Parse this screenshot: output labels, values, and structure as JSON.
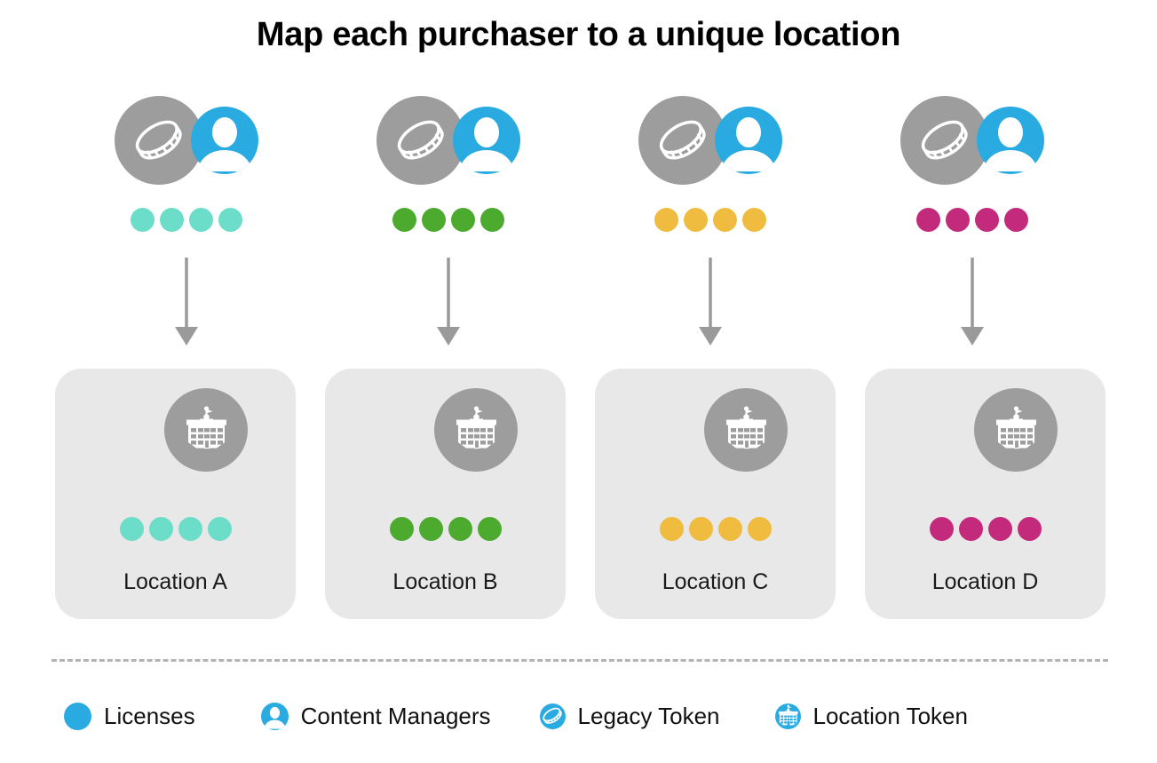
{
  "title": "Map each purchaser to a unique location",
  "colors": {
    "blue": "#29abe2",
    "gray_icon": "#9d9d9d",
    "card_bg": "#e8e8e8",
    "arrow": "#9a9a9a",
    "divider": "#b3b3b3",
    "teal": "#6bddc8",
    "green": "#4caa2e",
    "amber": "#efbc40",
    "magenta": "#c42a7c"
  },
  "purchasers": [
    {
      "token_icon": "legacy-token-icon",
      "person_icon": "content-manager-icon",
      "license_count": 4,
      "license_color": "#6bddc8"
    },
    {
      "token_icon": "legacy-token-icon",
      "person_icon": "content-manager-icon",
      "license_count": 4,
      "license_color": "#4caa2e"
    },
    {
      "token_icon": "legacy-token-icon",
      "person_icon": "content-manager-icon",
      "license_count": 4,
      "license_color": "#efbc40"
    },
    {
      "token_icon": "legacy-token-icon",
      "person_icon": "content-manager-icon",
      "license_count": 4,
      "license_color": "#c42a7c"
    }
  ],
  "arrows": [
    {
      "name": "arrow-down-a"
    },
    {
      "name": "arrow-down-b"
    },
    {
      "name": "arrow-down-c"
    },
    {
      "name": "arrow-down-d"
    }
  ],
  "locations": [
    {
      "label": "Location A",
      "token_icon": "location-token-icon",
      "license_count": 4,
      "license_color": "#6bddc8"
    },
    {
      "label": "Location B",
      "token_icon": "location-token-icon",
      "license_count": 4,
      "license_color": "#4caa2e"
    },
    {
      "label": "Location C",
      "token_icon": "location-token-icon",
      "license_count": 4,
      "license_color": "#efbc40"
    },
    {
      "label": "Location D",
      "token_icon": "location-token-icon",
      "license_count": 4,
      "license_color": "#c42a7c"
    }
  ],
  "legend": [
    {
      "label": "Licenses",
      "icon": "filled-circle-icon",
      "color": "#29abe2"
    },
    {
      "label": "Content Managers",
      "icon": "content-manager-icon",
      "color": "#29abe2"
    },
    {
      "label": "Legacy Token",
      "icon": "legacy-token-icon",
      "color": "#29abe2"
    },
    {
      "label": "Location Token",
      "icon": "location-token-icon",
      "color": "#29abe2"
    }
  ]
}
